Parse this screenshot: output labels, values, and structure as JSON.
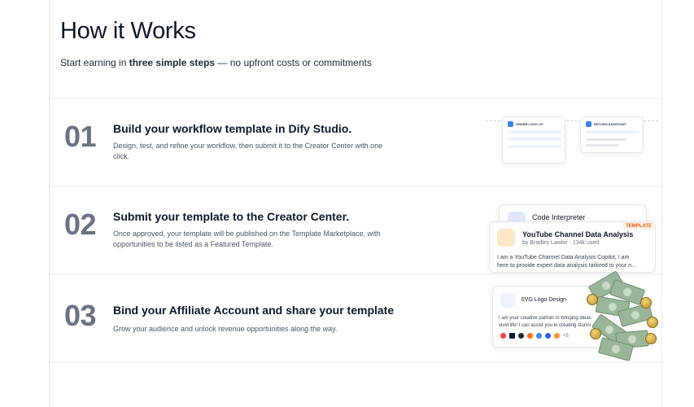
{
  "header": {
    "title": "How it Works",
    "subtitle_prefix": "Start earning in ",
    "subtitle_bold": "three simple steps",
    "subtitle_suffix": " — no upfront costs or commitments"
  },
  "steps": [
    {
      "number": "01",
      "title": "Build your workflow template in Dify Studio.",
      "description": "Design, test, and refine your workflow, then submit it to the Creator Center with one click.",
      "illustration": {
        "card1_title": "ORDER LOOK UP",
        "card2_title": "RETURN ASSISTANT"
      }
    },
    {
      "number": "02",
      "title": "Submit your template to the Creator Center.",
      "description": "Once approved, your template will be published on the Template Marketplace, with opportunities to be listed as a Featured Template.",
      "illustration": {
        "back_card_title": "Code Interpreter",
        "badge": "TEMPLATE",
        "front_card_title": "YouTube Channel Data Analysis",
        "front_card_meta": "by Bradley Lawlor  ·  134k used",
        "front_card_desc_1": "I am a YouTube Channel Data Analysis Copilot, I am",
        "front_card_desc_2": "here to provide expert data analysis tailored to your n..."
      }
    },
    {
      "number": "03",
      "title": "Bind your Affiliate Account and share your template",
      "description": "Grow your audience and unlock revenue opportunities along the way.",
      "illustration": {
        "card_title": "SVG Logo Design",
        "card_desc_1": "I am your creative partner in bringing ideas",
        "card_desc_2": "vivid life! I can assist you in creating stunni",
        "tools_more": "+5"
      }
    }
  ],
  "colors": {
    "step_number": "#6b7280",
    "accent_blue": "#3b82f6",
    "badge_orange": "#ea580c"
  }
}
